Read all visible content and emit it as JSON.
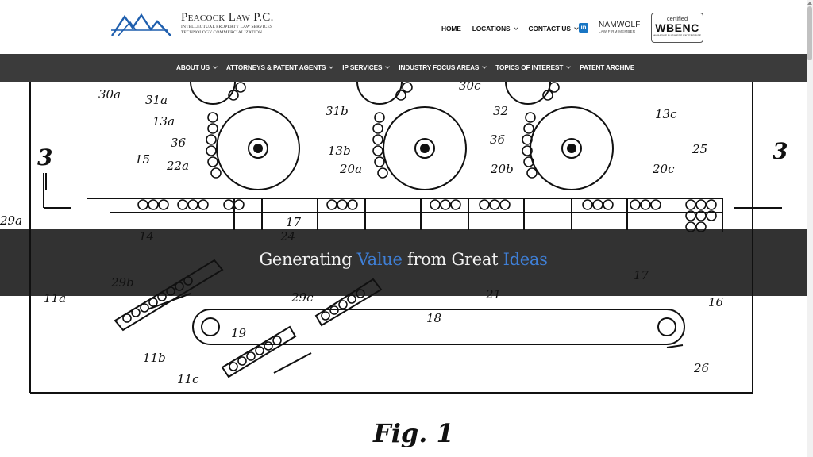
{
  "header": {
    "firm_name": "Peacock Law P.C.",
    "tagline_line1": "Intellectual Property Law Services",
    "tagline_line2": "Technology Commercialization",
    "logo_icon": "mountain-peaks-logo"
  },
  "top_nav": [
    {
      "label": "HOME",
      "has_dropdown": false
    },
    {
      "label": "LOCATIONS",
      "has_dropdown": true
    },
    {
      "label": "CONTACT US",
      "has_dropdown": true
    }
  ],
  "social": {
    "linkedin_icon": "linkedin-icon",
    "linkedin_glyph": "in"
  },
  "badges": {
    "namwolf_title": "NAMWOLF",
    "namwolf_sub": "LAW FIRM MEMBER",
    "wbenc_certified": "certified",
    "wbenc_name": "WBENC",
    "wbenc_sub": "WOMEN'S BUSINESS ENTERPRISE"
  },
  "main_nav": [
    {
      "label": "ABOUT US",
      "has_dropdown": true
    },
    {
      "label": "ATTORNEYS & PATENT AGENTS",
      "has_dropdown": true
    },
    {
      "label": "IP SERVICES",
      "has_dropdown": true
    },
    {
      "label": "INDUSTRY FOCUS AREAS",
      "has_dropdown": true
    },
    {
      "label": "TOPICS OF INTEREST",
      "has_dropdown": true
    },
    {
      "label": "PATENT ARCHIVE",
      "has_dropdown": false
    }
  ],
  "hero": {
    "tagline_part1": "Generating ",
    "tagline_part2": "Value",
    "tagline_part3": " from Great ",
    "tagline_part4": "Ideas",
    "highlight_color": "#3f7fd6",
    "drawing": {
      "figure_label": "Fig. 1",
      "ref_labels": [
        "30a",
        "31a",
        "13a",
        "36",
        "15",
        "22a",
        "3",
        "29a",
        "14",
        "17",
        "24",
        "11a",
        "29b",
        "11b",
        "11c",
        "19",
        "29c",
        "18",
        "31b",
        "13b",
        "20a",
        "30c",
        "32",
        "13c",
        "20b",
        "20c",
        "25",
        "3",
        "17",
        "21",
        "16",
        "26",
        "36"
      ]
    }
  }
}
